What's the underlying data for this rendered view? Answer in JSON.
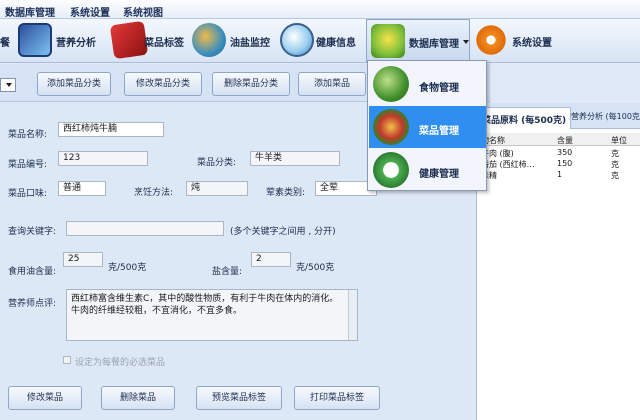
{
  "menubar": {
    "items": [
      "数据库管理",
      "系统设置",
      "系统视图"
    ]
  },
  "toolbar": {
    "items": [
      {
        "label": "餐",
        "icon": "meal-icon"
      },
      {
        "label": "营养分析",
        "icon": "nutrition-analysis-icon"
      },
      {
        "label": "菜品标签",
        "icon": "dish-label-icon"
      },
      {
        "label": "油盐监控",
        "icon": "oil-salt-monitor-icon"
      },
      {
        "label": "健康信息",
        "icon": "health-info-icon"
      },
      {
        "label": "数据库管理",
        "icon": "database-icon"
      },
      {
        "label": "系统设置",
        "icon": "gear-icon"
      }
    ]
  },
  "actions": {
    "add_category": "添加菜品分类",
    "edit_category": "修改菜品分类",
    "delete_category": "删除菜品分类",
    "add_dish": "添加菜品"
  },
  "form": {
    "dish_name_label": "菜品名称:",
    "dish_name": "西红柿炖牛腩",
    "dish_code_label": "菜品编号:",
    "dish_code": "123",
    "dish_category_label": "菜品分类:",
    "dish_category": "牛羊类",
    "taste_label": "菜品口味:",
    "taste": "普通",
    "cooking_label": "烹饪方法:",
    "cooking": "炖",
    "meat_type_label": "荤素类别:",
    "meat_type": "全荤",
    "keyword_label": "查询关键字:",
    "keyword": "",
    "keyword_hint": "(多个关键字之间用 , 分开)",
    "oil_label": "食用油含量:",
    "oil": "25",
    "oil_unit": "克/500克",
    "salt_label": "盐含量:",
    "salt": "2",
    "salt_unit": "克/500克",
    "comment_label": "营养师点评:",
    "comment": "西红柿富含维生素C，其中的酸性物质，有利于牛肉在体内的消化。牛肉的纤维经较粗，不宜消化，不宜多食。",
    "required_checkbox": "设定为每餐的必选菜品"
  },
  "bottom_buttons": {
    "edit": "修改菜品",
    "delete": "删除菜品",
    "preview": "预览菜品标签",
    "print": "打印菜品标签"
  },
  "right_panel": {
    "tab_active": "菜品原料 (每500克)",
    "tab_other": "营养分析 (每100克",
    "columns": [
      "物名称",
      "含量",
      "单位"
    ],
    "rows": [
      {
        "name": "牛肉 (腹)",
        "amount": "350",
        "unit": "克"
      },
      {
        "name": "番茄 (西红柿…",
        "amount": "150",
        "unit": "克"
      },
      {
        "name": "味精",
        "amount": "1",
        "unit": "克"
      }
    ]
  },
  "dropdown": {
    "items": [
      {
        "label": "食物管理",
        "icon": "food-icon"
      },
      {
        "label": "菜品管理",
        "icon": "dish-icon"
      },
      {
        "label": "健康管理",
        "icon": "health-icon"
      }
    ]
  },
  "colors": {
    "highlight": "#2f8ff0",
    "background": "#dfe9f7"
  }
}
